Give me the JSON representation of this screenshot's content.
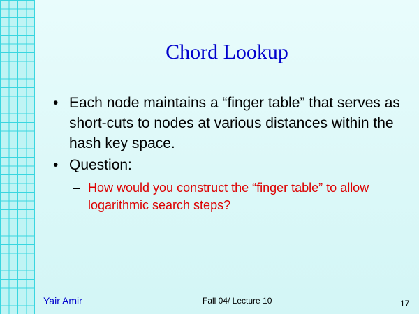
{
  "slide": {
    "title": "Chord Lookup",
    "bullets": [
      {
        "marker": "•",
        "text": "Each node maintains a “finger table” that serves as short-cuts to nodes at various distances within the hash key space."
      },
      {
        "marker": "•",
        "text": "Question:"
      }
    ],
    "sub_bullet": {
      "marker": "–",
      "text": "How would you construct the “finger table” to allow logarithmic search steps?"
    },
    "footer": {
      "author": "Yair Amir",
      "course": "Fall 04/ Lecture 10",
      "page_number": "17"
    }
  },
  "colors": {
    "title": "#0000cc",
    "sub_bullet_text": "#dd0000",
    "grid_line": "#39d6e0",
    "background": "#dcf8f8"
  }
}
